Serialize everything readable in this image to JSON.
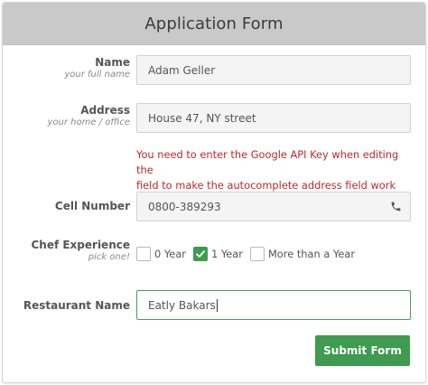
{
  "form": {
    "title": "Application Form",
    "name": {
      "label": "Name",
      "sublabel": "your full name",
      "value": "Adam Geller"
    },
    "address": {
      "label": "Address",
      "sublabel": "your home / office",
      "value": "House 47, NY street",
      "error_line1": "You need to enter the Google API Key when editing the",
      "error_line2": "field to make the autocomplete address field work"
    },
    "cell": {
      "label": "Cell Number",
      "value": "0800-389293",
      "icon": "phone-icon"
    },
    "experience": {
      "label": "Chef Experience",
      "sublabel": "pick one!",
      "options": [
        {
          "label": "0 Year",
          "checked": false
        },
        {
          "label": "1 Year",
          "checked": true
        },
        {
          "label": "More than a Year",
          "checked": false
        }
      ]
    },
    "restaurant": {
      "label": "Restaurant Name",
      "value": "Eatly Bakars"
    },
    "submit_label": "Submit Form"
  },
  "colors": {
    "accent": "#3e9b4f",
    "header_bg": "#c9c9c9",
    "error": "#c0272d"
  }
}
